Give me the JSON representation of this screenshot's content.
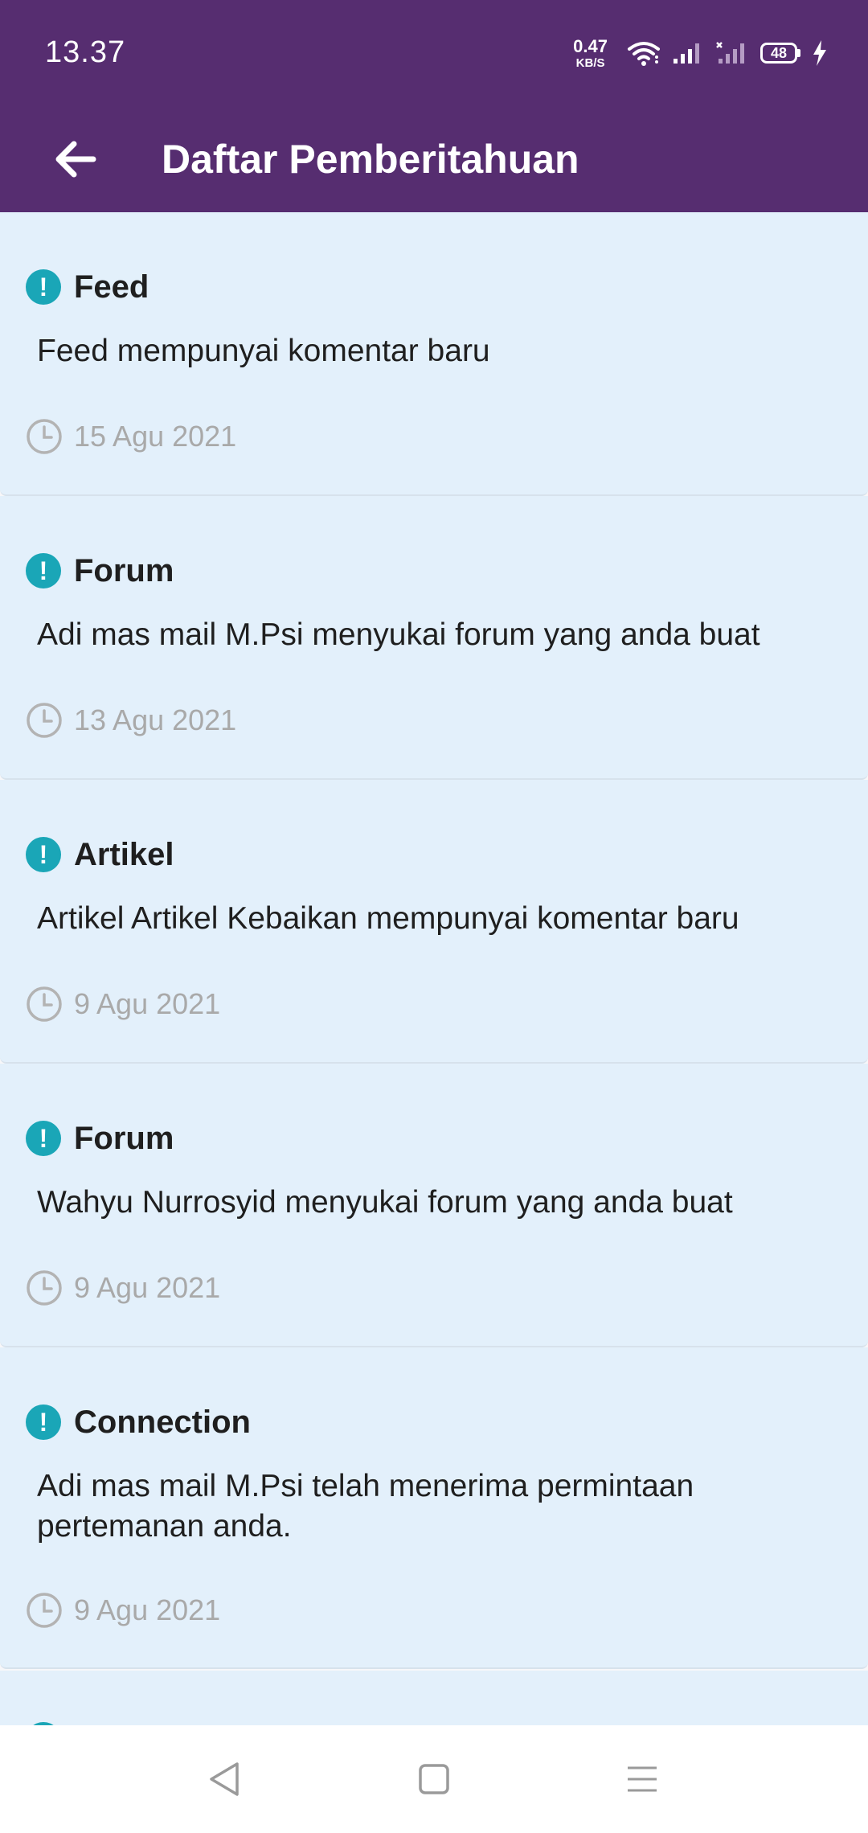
{
  "status_bar": {
    "time": "13.37",
    "net_speed_value": "0.47",
    "net_speed_unit": "KB/S",
    "battery_level": "48",
    "icons": [
      "wifi-icon",
      "signal-icon",
      "signal-no-service-icon",
      "battery-icon",
      "charging-icon"
    ]
  },
  "appbar": {
    "title": "Daftar Pemberitahuan",
    "back_icon": "arrow-left-icon"
  },
  "notifications": [
    {
      "category": "Feed",
      "message": "Feed  mempunyai komentar baru",
      "date": "15 Agu 2021"
    },
    {
      "category": "Forum",
      "message": "Adi mas mail M.Psi menyukai forum yang anda buat",
      "date": "13 Agu 2021"
    },
    {
      "category": "Artikel",
      "message": "Artikel Artikel Kebaikan mempunyai komentar baru",
      "date": "9 Agu 2021"
    },
    {
      "category": "Forum",
      "message": "Wahyu Nurrosyid menyukai forum yang anda buat",
      "date": "9 Agu 2021"
    },
    {
      "category": "Connection",
      "message": "Adi mas mail M.Psi telah menerima permintaan pertemanan anda.",
      "date": "9 Agu 2021"
    }
  ],
  "navbar": {
    "icons": [
      "nav-back-icon",
      "nav-home-icon",
      "nav-menu-icon"
    ]
  },
  "colors": {
    "primary": "#562d70",
    "card_bg": "#e3f0fb",
    "info_icon": "#1aa6b7",
    "date_text": "#a9a9a9"
  }
}
